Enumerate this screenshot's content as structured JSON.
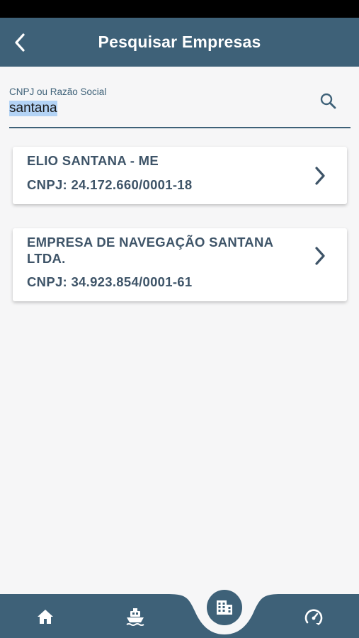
{
  "header": {
    "title": "Pesquisar Empresas",
    "back_icon": "chevron-left-icon"
  },
  "search": {
    "label": "CNPJ ou Razão Social",
    "value": "santana",
    "icon": "search-icon"
  },
  "results": [
    {
      "name": "ELIO SANTANA - ME",
      "cnpj": "CNPJ: 24.172.660/0001-18"
    },
    {
      "name": "EMPRESA DE NAVEGAÇÃO SANTANA LTDA.",
      "cnpj": "CNPJ: 34.923.854/0001-61"
    }
  ],
  "bottom_nav": {
    "items": [
      "home-icon",
      "ship-icon",
      "building-icon",
      "gauge-icon"
    ],
    "active": "building-icon"
  },
  "colors": {
    "primary": "#3e6178",
    "text_dark": "#3e5468",
    "background": "#f6f6f7"
  }
}
